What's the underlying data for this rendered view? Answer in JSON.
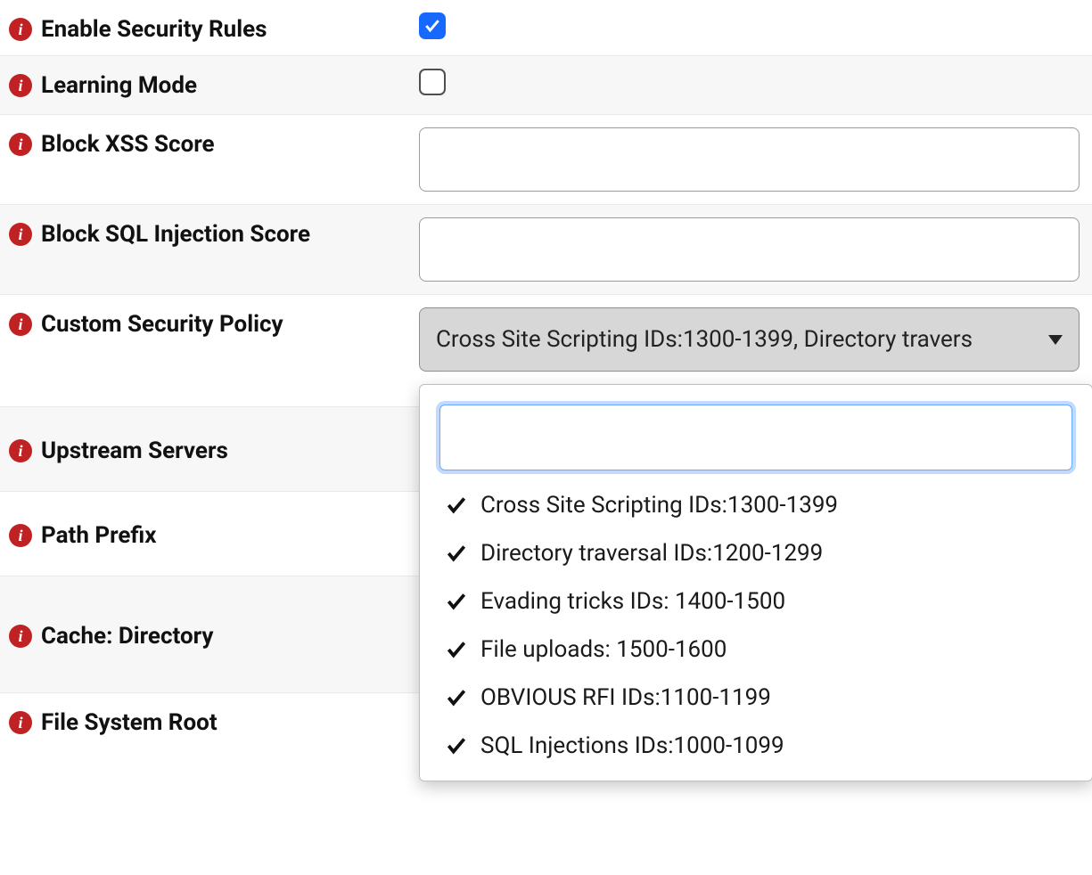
{
  "rows": {
    "enable_security_rules": {
      "label": "Enable Security Rules",
      "checked": true
    },
    "learning_mode": {
      "label": "Learning Mode",
      "checked": false
    },
    "block_xss_score": {
      "label": "Block XSS Score",
      "value": ""
    },
    "block_sql_injection_score": {
      "label": "Block SQL Injection Score",
      "value": ""
    },
    "custom_security_policy": {
      "label": "Custom Security Policy",
      "selected_display": "Cross Site Scripting IDs:1300-1399, Directory travers",
      "search_value": "",
      "options": [
        {
          "label": "Cross Site Scripting IDs:1300-1399",
          "selected": true
        },
        {
          "label": "Directory traversal IDs:1200-1299",
          "selected": true
        },
        {
          "label": "Evading tricks IDs: 1400-1500",
          "selected": true
        },
        {
          "label": "File uploads: 1500-1600",
          "selected": true
        },
        {
          "label": "OBVIOUS RFI IDs:1100-1199",
          "selected": true
        },
        {
          "label": "SQL Injections IDs:1000-1099",
          "selected": true
        }
      ]
    },
    "upstream_servers": {
      "label": "Upstream Servers"
    },
    "path_prefix": {
      "label": "Path Prefix"
    },
    "cache_directory": {
      "label": "Cache: Directory"
    },
    "file_system_root": {
      "label": "File System Root"
    }
  }
}
